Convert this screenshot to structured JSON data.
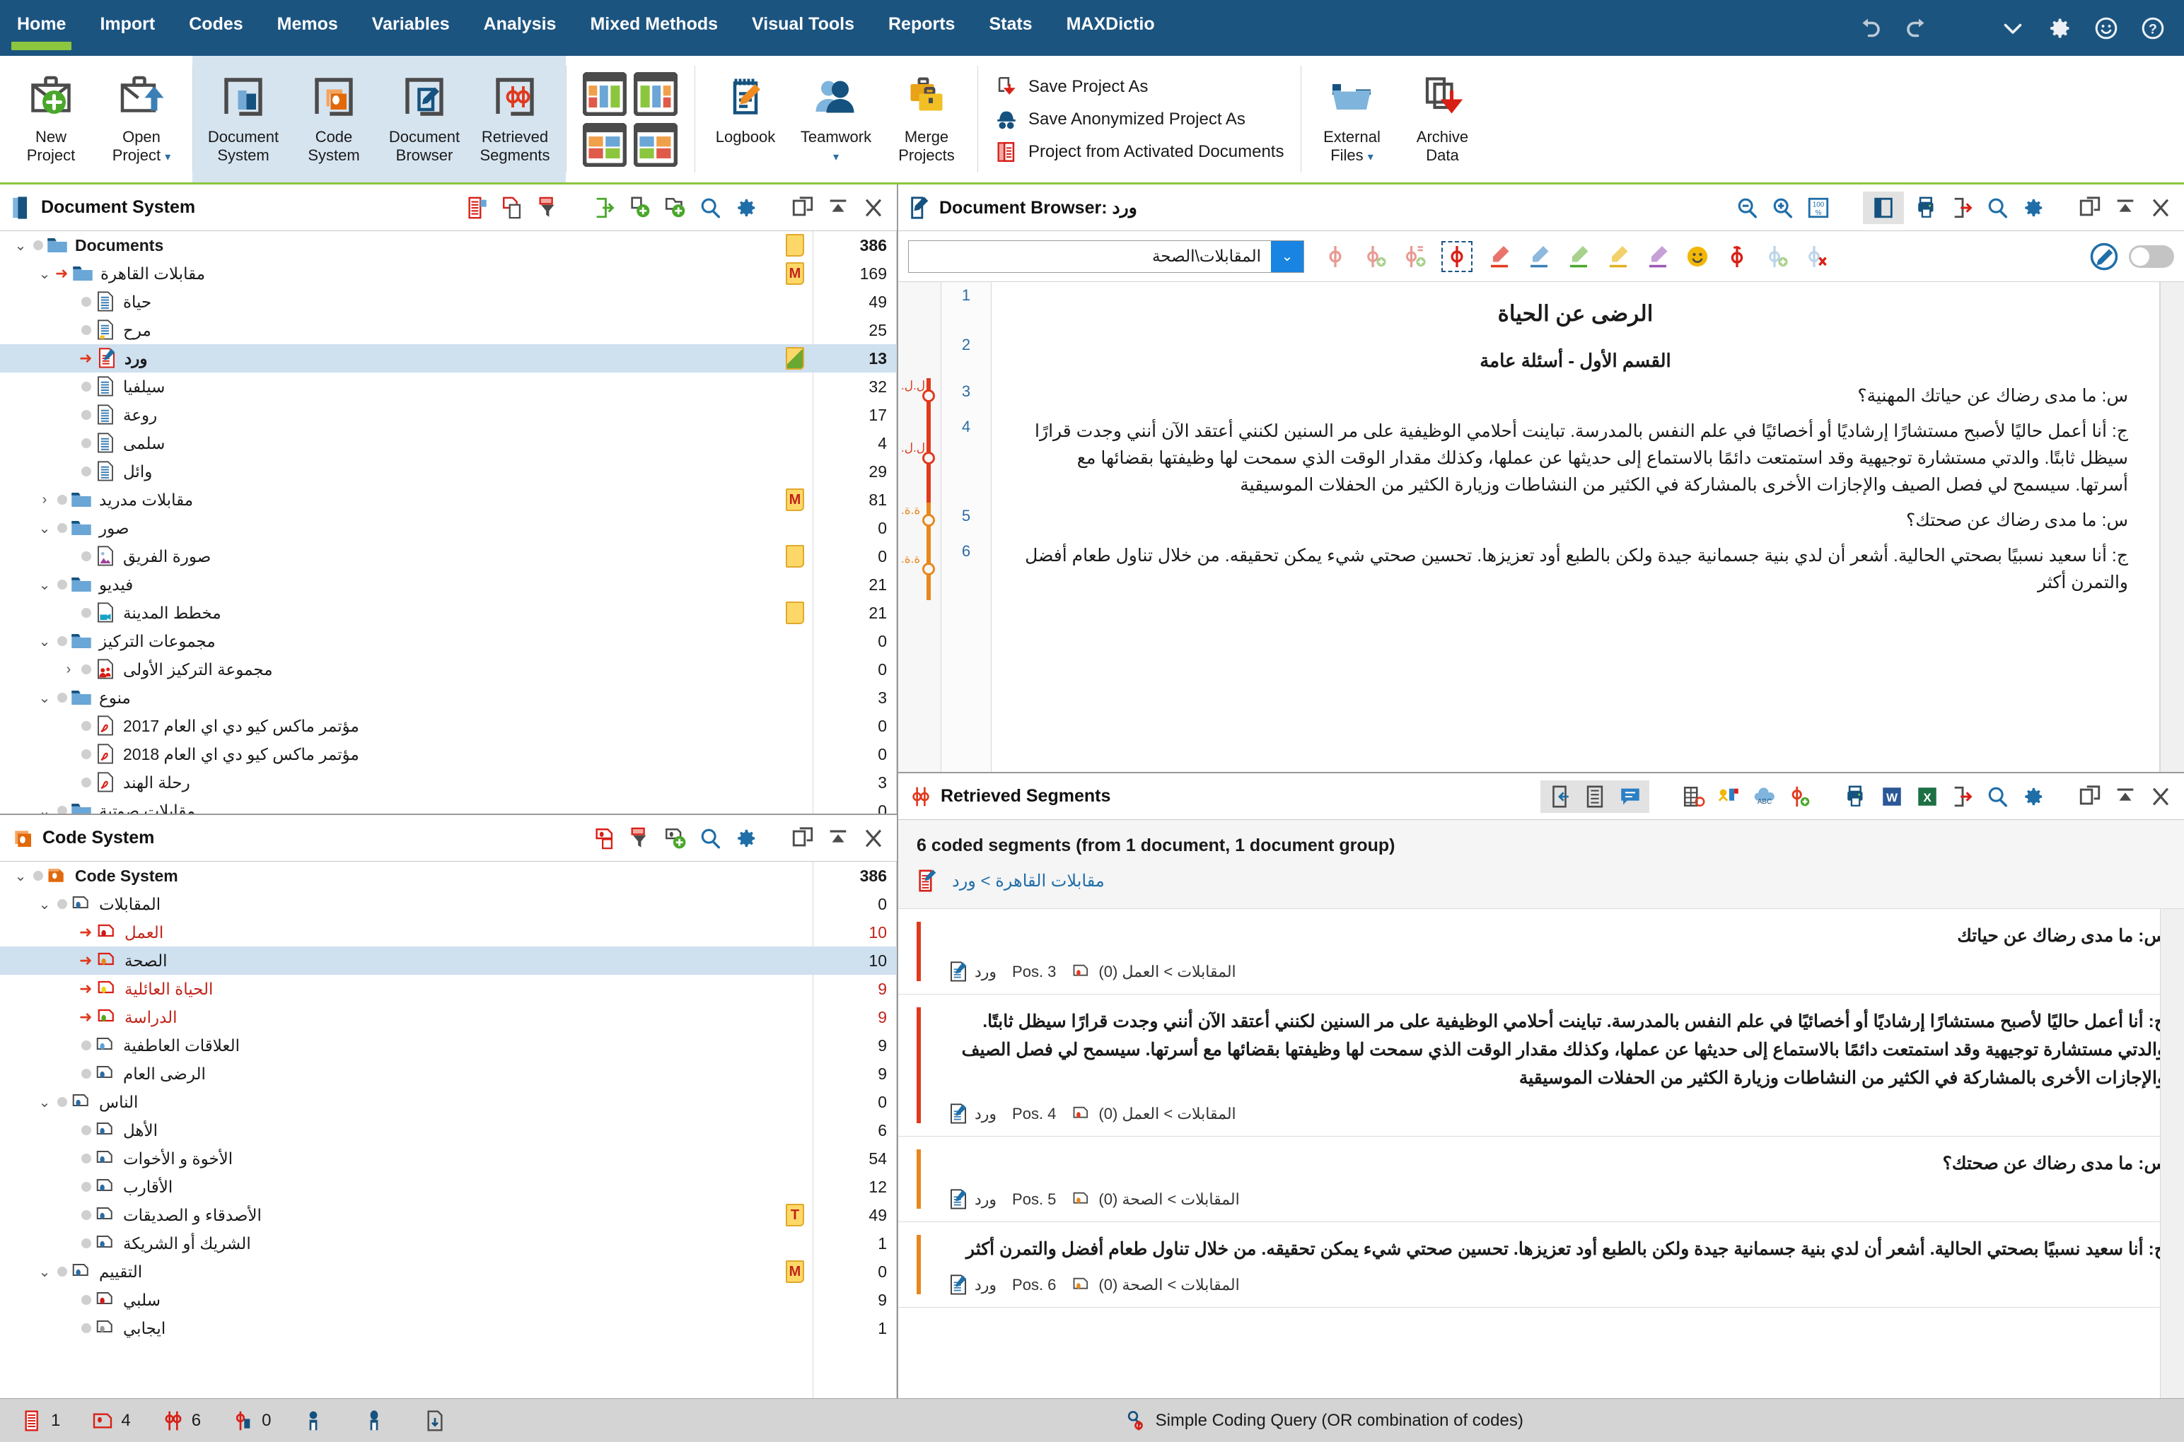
{
  "ribbon": {
    "tabs": [
      {
        "label": "Home",
        "active": true
      },
      {
        "label": "Import",
        "active": false
      },
      {
        "label": "Codes",
        "active": false
      },
      {
        "label": "Memos",
        "active": false
      },
      {
        "label": "Variables",
        "active": false
      },
      {
        "label": "Analysis",
        "active": false
      },
      {
        "label": "Mixed Methods",
        "active": false
      },
      {
        "label": "Visual Tools",
        "active": false
      },
      {
        "label": "Reports",
        "active": false
      },
      {
        "label": "Stats",
        "active": false
      },
      {
        "label": "MAXDictio",
        "active": false
      }
    ],
    "window_icons": [
      "undo-icon",
      "redo-icon",
      "chevron-down-icon",
      "gear-icon",
      "smiley-icon",
      "help-icon"
    ],
    "group_project": [
      {
        "label": "New\nProject",
        "icon": "new-project-icon",
        "caret": false
      },
      {
        "label": "Open\nProject",
        "icon": "open-project-icon",
        "caret": true
      }
    ],
    "group_windows": [
      {
        "label": "Document\nSystem",
        "icon": "document-system-icon"
      },
      {
        "label": "Code\nSystem",
        "icon": "code-system-icon"
      },
      {
        "label": "Document\nBrowser",
        "icon": "document-browser-icon"
      },
      {
        "label": "Retrieved\nSegments",
        "icon": "retrieved-segments-icon"
      }
    ],
    "group_logbook": [
      {
        "label": "Logbook",
        "icon": "logbook-icon",
        "caret": false
      },
      {
        "label": "Teamwork",
        "icon": "teamwork-icon",
        "caret": true
      },
      {
        "label": "Merge\nProjects",
        "icon": "merge-projects-icon",
        "caret": false
      }
    ],
    "group_save": [
      {
        "label": "Save Project As",
        "icon": "save-project-as-icon"
      },
      {
        "label": "Save Anonymized Project As",
        "icon": "save-anonymized-icon"
      },
      {
        "label": "Project from Activated Documents",
        "icon": "project-from-activated-icon"
      }
    ],
    "group_data": [
      {
        "label": "External\nFiles",
        "icon": "external-files-icon",
        "caret": true
      },
      {
        "label": "Archive\nData",
        "icon": "archive-data-icon",
        "caret": false
      }
    ]
  },
  "document_system": {
    "title": "Document System",
    "toolbar_icons": [
      "activate-documents-icon",
      "copy-documents-icon",
      "filter-documents-icon",
      "import-icon",
      "new-document-icon",
      "new-document-group-icon",
      "search-icon",
      "gear-icon",
      "undock-icon",
      "collapse-icon",
      "close-icon"
    ],
    "rows": [
      {
        "name": "Documents",
        "en": true,
        "level": 0,
        "twisty": "v",
        "icon": "folder",
        "memo": "note",
        "count": "386",
        "bold": true,
        "activated": false
      },
      {
        "name": "مقابلات القاهرة",
        "en": false,
        "level": 1,
        "twisty": "v",
        "icon": "folder",
        "memo": "M",
        "count": "169",
        "bold": false,
        "activated": true
      },
      {
        "name": "حياة",
        "en": false,
        "level": 2,
        "twisty": "",
        "icon": "doc",
        "memo": "",
        "count": "49",
        "bold": false,
        "activated": false
      },
      {
        "name": "مرح",
        "en": false,
        "level": 2,
        "twisty": "",
        "icon": "doc-y",
        "memo": "",
        "count": "25",
        "bold": false,
        "activated": false
      },
      {
        "name": "ورد",
        "en": false,
        "level": 2,
        "twisty": "",
        "icon": "doc-edit",
        "memo": "half",
        "count": "13",
        "bold": true,
        "activated": true,
        "selected": true
      },
      {
        "name": "سيلفيا",
        "en": false,
        "level": 2,
        "twisty": "",
        "icon": "doc",
        "memo": "",
        "count": "32",
        "bold": false,
        "activated": false
      },
      {
        "name": "روعة",
        "en": false,
        "level": 2,
        "twisty": "",
        "icon": "doc",
        "memo": "",
        "count": "17",
        "bold": false,
        "activated": false
      },
      {
        "name": "سلمى",
        "en": false,
        "level": 2,
        "twisty": "",
        "icon": "doc",
        "memo": "",
        "count": "4",
        "bold": false,
        "activated": false
      },
      {
        "name": "وائل",
        "en": false,
        "level": 2,
        "twisty": "",
        "icon": "doc",
        "memo": "",
        "count": "29",
        "bold": false,
        "activated": false
      },
      {
        "name": "مقابلات مدريد",
        "en": false,
        "level": 1,
        "twisty": ">",
        "icon": "folder",
        "memo": "M",
        "count": "81",
        "bold": false,
        "activated": false
      },
      {
        "name": "صور",
        "en": false,
        "level": 1,
        "twisty": "v",
        "icon": "folder",
        "memo": "",
        "count": "0",
        "bold": false,
        "activated": false
      },
      {
        "name": "صورة الفريق",
        "en": false,
        "level": 2,
        "twisty": "",
        "icon": "doc-img",
        "memo": "note",
        "count": "0",
        "bold": false,
        "activated": false
      },
      {
        "name": "فيديو",
        "en": false,
        "level": 1,
        "twisty": "v",
        "icon": "folder",
        "memo": "",
        "count": "21",
        "bold": false,
        "activated": false
      },
      {
        "name": "مخطط المدينة",
        "en": false,
        "level": 2,
        "twisty": "",
        "icon": "doc-vid",
        "memo": "note",
        "count": "21",
        "bold": false,
        "activated": false
      },
      {
        "name": "مجموعات التركيز",
        "en": false,
        "level": 1,
        "twisty": "v",
        "icon": "folder",
        "memo": "",
        "count": "0",
        "bold": false,
        "activated": false
      },
      {
        "name": "مجموعة التركيز الأولى",
        "en": false,
        "level": 2,
        "twisty": ">",
        "icon": "doc-grp",
        "memo": "",
        "count": "0",
        "bold": false,
        "activated": false
      },
      {
        "name": "منوع",
        "en": false,
        "level": 1,
        "twisty": "v",
        "icon": "folder",
        "memo": "",
        "count": "3",
        "bold": false,
        "activated": false
      },
      {
        "name": "مؤتمر ماكس كيو دي اي العام 2017",
        "en": false,
        "level": 2,
        "twisty": "",
        "icon": "doc-pdf",
        "memo": "",
        "count": "0",
        "bold": false,
        "activated": false
      },
      {
        "name": "مؤتمر ماكس كيو دي اي العام 2018",
        "en": false,
        "level": 2,
        "twisty": "",
        "icon": "doc-pdf",
        "memo": "",
        "count": "0",
        "bold": false,
        "activated": false
      },
      {
        "name": "رحلة الهند",
        "en": false,
        "level": 2,
        "twisty": "",
        "icon": "doc-pdf",
        "memo": "",
        "count": "3",
        "bold": false,
        "activated": false
      },
      {
        "name": "مقابلات صوتية",
        "en": false,
        "level": 1,
        "twisty": "v",
        "icon": "folder",
        "memo": "",
        "count": "0",
        "bold": false,
        "activated": false
      }
    ]
  },
  "code_system": {
    "title": "Code System",
    "toolbar_icons": [
      "activate-codes-icon",
      "filter-codes-icon",
      "new-code-icon",
      "search-icon",
      "gear-icon",
      "undock-icon",
      "collapse-icon",
      "close-icon"
    ],
    "rows": [
      {
        "name": "Code System",
        "en": true,
        "level": 0,
        "twisty": "v",
        "color": "",
        "count": "386",
        "bold": true,
        "activated": false,
        "memo": ""
      },
      {
        "name": "المقابلات",
        "en": false,
        "level": 1,
        "twisty": "v",
        "color": "#2b6ca3",
        "count": "0",
        "bold": false,
        "activated": false,
        "memo": ""
      },
      {
        "name": "العمل",
        "en": false,
        "level": 2,
        "twisty": "",
        "color": "#d0181a",
        "count": "10",
        "bold": false,
        "activated": true,
        "memo": "",
        "red": true
      },
      {
        "name": "الصحة",
        "en": false,
        "level": 2,
        "twisty": "",
        "color": "#e8871b",
        "count": "10",
        "bold": false,
        "activated": true,
        "memo": "",
        "selected": true
      },
      {
        "name": "الحياة العائلية",
        "en": false,
        "level": 2,
        "twisty": "",
        "color": "#e8d31b",
        "count": "9",
        "bold": false,
        "activated": true,
        "memo": "",
        "red": true
      },
      {
        "name": "الدراسة",
        "en": false,
        "level": 2,
        "twisty": "",
        "color": "#4caa1e",
        "count": "9",
        "bold": false,
        "activated": true,
        "memo": "",
        "red": true
      },
      {
        "name": "العلاقات العاطفية",
        "en": false,
        "level": 2,
        "twisty": "",
        "color": "#5ba3dc",
        "count": "9",
        "bold": false,
        "activated": false,
        "memo": ""
      },
      {
        "name": "الرضى العام",
        "en": false,
        "level": 2,
        "twisty": "",
        "color": "#2b6ca3",
        "count": "9",
        "bold": false,
        "activated": false,
        "memo": ""
      },
      {
        "name": "الناس",
        "en": false,
        "level": 1,
        "twisty": "v",
        "color": "#2b6ca3",
        "count": "0",
        "bold": false,
        "activated": false,
        "memo": ""
      },
      {
        "name": "الأهل",
        "en": false,
        "level": 2,
        "twisty": "",
        "color": "#2b6ca3",
        "count": "6",
        "bold": false,
        "activated": false,
        "memo": ""
      },
      {
        "name": "الأخوة و الأخوات",
        "en": false,
        "level": 2,
        "twisty": "",
        "color": "#2b6ca3",
        "count": "54",
        "bold": false,
        "activated": false,
        "memo": ""
      },
      {
        "name": "الأقارب",
        "en": false,
        "level": 2,
        "twisty": "",
        "color": "#2b6ca3",
        "count": "12",
        "bold": false,
        "activated": false,
        "memo": ""
      },
      {
        "name": "الأصدقاء و الصديقات",
        "en": false,
        "level": 2,
        "twisty": "",
        "color": "#2b6ca3",
        "count": "49",
        "bold": false,
        "activated": false,
        "memo": "T"
      },
      {
        "name": "الشريك أو الشريكة",
        "en": false,
        "level": 2,
        "twisty": "",
        "color": "#2b6ca3",
        "count": "1",
        "bold": false,
        "activated": false,
        "memo": ""
      },
      {
        "name": "التقييم",
        "en": false,
        "level": 1,
        "twisty": "v",
        "color": "#2b6ca3",
        "count": "0",
        "bold": false,
        "activated": false,
        "memo": "M"
      },
      {
        "name": "سلبي",
        "en": false,
        "level": 2,
        "twisty": "",
        "color": "#d0181a",
        "count": "9",
        "bold": false,
        "activated": false,
        "memo": ""
      },
      {
        "name": "ايجابي",
        "en": false,
        "level": 2,
        "twisty": "",
        "color": "#9a9a9a",
        "count": "1",
        "bold": false,
        "activated": false,
        "memo": ""
      }
    ]
  },
  "document_browser": {
    "title": "Document Browser:",
    "document_name": "ورد",
    "toolbar_icons": [
      "zoom-out-icon",
      "zoom-in-icon",
      "zoom-100-icon",
      "sidebar-toggle-icon",
      "print-icon",
      "export-icon",
      "search-icon",
      "gear-icon",
      "undock-icon",
      "collapse-icon",
      "close-icon"
    ],
    "code_selector_value": "المقابلات\\الصحة",
    "edit_toolbar_icons": [
      "code-icon",
      "code-new-icon",
      "code-inline-icon",
      "code-highlight-icon",
      "highlighter-red-icon",
      "highlighter-blue-icon",
      "highlighter-green-icon",
      "highlighter-yellow-icon",
      "highlighter-purple-icon",
      "emoticode-icon",
      "code-undo-icon",
      "code-refresh-icon",
      "code-delete-icon"
    ],
    "edit_mode_label": "edit-mode-toggle",
    "paragraphs": [
      {
        "num": "1",
        "text": "الرضى عن الحياة",
        "style": "title"
      },
      {
        "num": "2",
        "text": "القسم الأول - أسئلة عامة",
        "style": "sub"
      },
      {
        "num": "3",
        "text": "س: ما مدى رضاك عن حياتك المهنية؟",
        "style": "body"
      },
      {
        "num": "4",
        "text": "ج: أنا أعمل حاليًا لأصبح مستشارًا إرشاديًا أو أخصائيًا في علم النفس بالمدرسة.  تباينت  أحلامي الوظيفية على مر السنين  لكنني أعتقد الآن أنني وجدت قرارًا سيظل ثابتًا. والدتي مستشارة توجيهية وقد استمتعت دائمًا بالاستماع إلى حديثها عن عملها، وكذلك مقدار الوقت الذي سمحت لها وظيفتها بقضائها مع أسرتها. سيسمح لي فصل الصيف والإجازات الأخرى بالمشاركة في الكثير من النشاطات وزيارة الكثير من الحفلات الموسيقية",
        "style": "body"
      },
      {
        "num": "5",
        "text": "س: ما مدى رضاك عن صحتك؟",
        "style": "body"
      },
      {
        "num": "6",
        "text": "ج: أنا سعيد نسبيًا بصحتي الحالية. أشعر أن لدي بنية جسمانية جيدة ولكن بالطبع أود تعزيزها. تحسين صحتي شيء يمكن تحقيقه. من خلال تناول طعام  أفضل والتمرن أكثر",
        "style": "body"
      }
    ],
    "margin_codes": [
      {
        "label": "ل.ل.",
        "color": "#e03a1e"
      },
      {
        "label": "ل.ل.",
        "color": "#e03a1e"
      },
      {
        "label": "ة.ة.",
        "color": "#e8871b"
      },
      {
        "label": "ة.ة.",
        "color": "#e8871b"
      }
    ]
  },
  "retrieved_segments": {
    "title": "Retrieved Segments",
    "toolbar_icons": [
      "insert-segment-icon",
      "overview-icon",
      "comment-icon",
      "table-icon",
      "summary-icon",
      "code-map-icon",
      "word-cloud-icon",
      "new-code-icon",
      "print-icon",
      "export-word-icon",
      "export-excel-icon",
      "export-icon",
      "search-icon",
      "gear-icon",
      "undock-icon",
      "collapse-icon",
      "close-icon"
    ],
    "count_label": "6 coded segments (from 1 document, 1 document group)",
    "group_label": "مقابلات القاهرة > ورد",
    "segments": [
      {
        "text": "س: ما مدى رضاك عن حياتك",
        "code": "المقابلات > العمل (0)",
        "pos": "Pos. 3",
        "doc": "ورد",
        "color": "#e03a1e"
      },
      {
        "text": "ج: أنا أعمل حاليًا لأصبح مستشارًا إرشاديًا أو أخصائيًا في علم النفس بالمدرسة.  تباينت  أحلامي الوظيفية على مر السنين  لكنني أعتقد الآن أنني وجدت قرارًا سيظل ثابتًا. والدتي مستشارة توجيهية وقد استمتعت دائمًا بالاستماع إلى حديثها عن عملها، وكذلك مقدار الوقت الذي سمحت لها وظيفتها بقضائها مع أسرتها. سيسمح لي فصل الصيف والإجازات الأخرى بالمشاركة في الكثير من النشاطات وزيارة الكثير من الحفلات الموسيقية",
        "code": "المقابلات > العمل (0)",
        "pos": "Pos. 4",
        "doc": "ورد",
        "color": "#e03a1e"
      },
      {
        "text": "س: ما مدى رضاك عن صحتك؟",
        "code": "المقابلات > الصحة (0)",
        "pos": "Pos. 5",
        "doc": "ورد",
        "color": "#e8871b"
      },
      {
        "text": "ج: أنا سعيد نسبيًا بصحتي الحالية. أشعر أن لدي بنية جسمانية جيدة ولكن بالطبع أود تعزيزها. تحسين صحتي شيء يمكن تحقيقه. من خلال تناول طعام  أفضل والتمرن أكثر",
        "code": "المقابلات > الصحة (0)",
        "pos": "Pos. 6",
        "doc": "ورد",
        "color": "#e8871b"
      }
    ]
  },
  "statusbar": {
    "items": [
      {
        "icon": "documents-count-icon",
        "value": "1"
      },
      {
        "icon": "codes-count-icon",
        "value": "4"
      },
      {
        "icon": "coded-segments-icon",
        "value": "6"
      },
      {
        "icon": "activated-codes-icon",
        "value": "0"
      },
      {
        "icon": "memo-count-icon",
        "value": ""
      },
      {
        "icon": "user-icon",
        "value": ""
      },
      {
        "icon": "page-icon",
        "value": ""
      }
    ],
    "query": "Simple Coding Query (OR combination of codes)",
    "query_icon": "coding-query-icon"
  },
  "colors": {
    "ribbon_blue": "#1c5480",
    "accent_green": "#8cc63e",
    "selection": "#cfe0ef",
    "code_red": "#e03a1e",
    "code_orange": "#e8871b",
    "link_blue": "#1f6ea8"
  }
}
